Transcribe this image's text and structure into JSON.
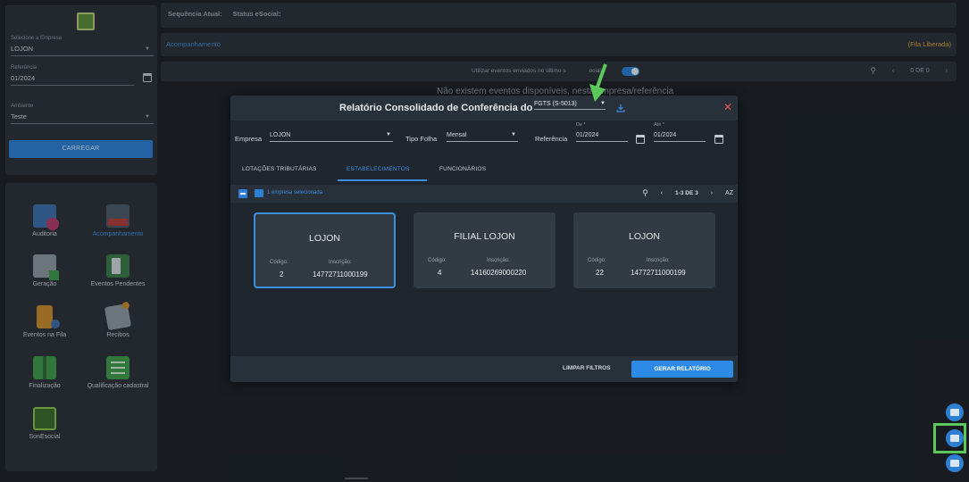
{
  "sidebar": {
    "empresa_label": "Selecione a Empresa",
    "empresa_value": "LOJON",
    "referencia_label": "Referência",
    "referencia_value": "01/2024",
    "ambiente_label": "Ambiente",
    "ambiente_value": "Teste",
    "carregar_label": "CARREGAR",
    "tiles": [
      {
        "label": "Auditoria",
        "icon": "audit-icon"
      },
      {
        "label": "Acompanhamento",
        "icon": "tracking-icon"
      },
      {
        "label": "Geração",
        "icon": "document-icon"
      },
      {
        "label": "Eventos Pendentes",
        "icon": "pending-icon"
      },
      {
        "label": "Eventos na Fila",
        "icon": "hourglass-icon"
      },
      {
        "label": "Recibos",
        "icon": "receipt-icon"
      },
      {
        "label": "Finalização",
        "icon": "finish-icon"
      },
      {
        "label": "Qualificação cadastral",
        "icon": "checklist-icon"
      },
      {
        "label": "SonEsocial",
        "icon": "esocial-icon"
      }
    ]
  },
  "header": {
    "sequencia_label": "Sequência Atual:",
    "status_label": "Status eSocial:",
    "section_title": "Acompanhamento",
    "queue_status": "(Fila Liberada)",
    "toggle_text": "Utilizar eventos enviados no último s",
    "toggle_text_after": "ocial",
    "pagination": "0 DE 0",
    "no_events": "Não existem eventos disponíveis, nesta empresa/referência"
  },
  "modal": {
    "title": "Relatório Consolidado de Conferência do",
    "report_type": "FGTS (S-5013)",
    "empresa_label": "Empresa",
    "empresa_value": "LOJON",
    "tipo_folha_label": "Tipo Folha",
    "tipo_folha_value": "Mensal",
    "referencia_label": "Referência",
    "de_label": "De *",
    "de_value": "01/2024",
    "ate_label": "Até *",
    "ate_value": "01/2024",
    "tabs": [
      "LOTAÇÕES TRIBUTÁRIAS",
      "ESTABELECIMENTOS",
      "FUNCIONÁRIOS"
    ],
    "selection_text": "1 empresa selecionada",
    "pagination": "1-3 DE 3",
    "sort_label": "AZ",
    "cards": [
      {
        "name": "LOJON",
        "codigo_label": "Código:",
        "codigo": "2",
        "inscricao_label": "Inscrição:",
        "inscricao": "14772711000199",
        "selected": true
      },
      {
        "name": "FILIAL LOJON",
        "codigo_label": "Código:",
        "codigo": "4",
        "inscricao_label": "Inscrição:",
        "inscricao": "14160269000220",
        "selected": false
      },
      {
        "name": "LOJON",
        "codigo_label": "Código:",
        "codigo": "22",
        "inscricao_label": "Inscrição:",
        "inscricao": "14772711000199",
        "selected": false
      }
    ],
    "limpar_label": "LIMPAR FILTROS",
    "gerar_label": "GERAR RELATÓRIO"
  },
  "colors": {
    "accent": "#2d7fd3",
    "warning": "#d9a63a",
    "close": "#e05555",
    "highlight": "#5ac85a"
  }
}
